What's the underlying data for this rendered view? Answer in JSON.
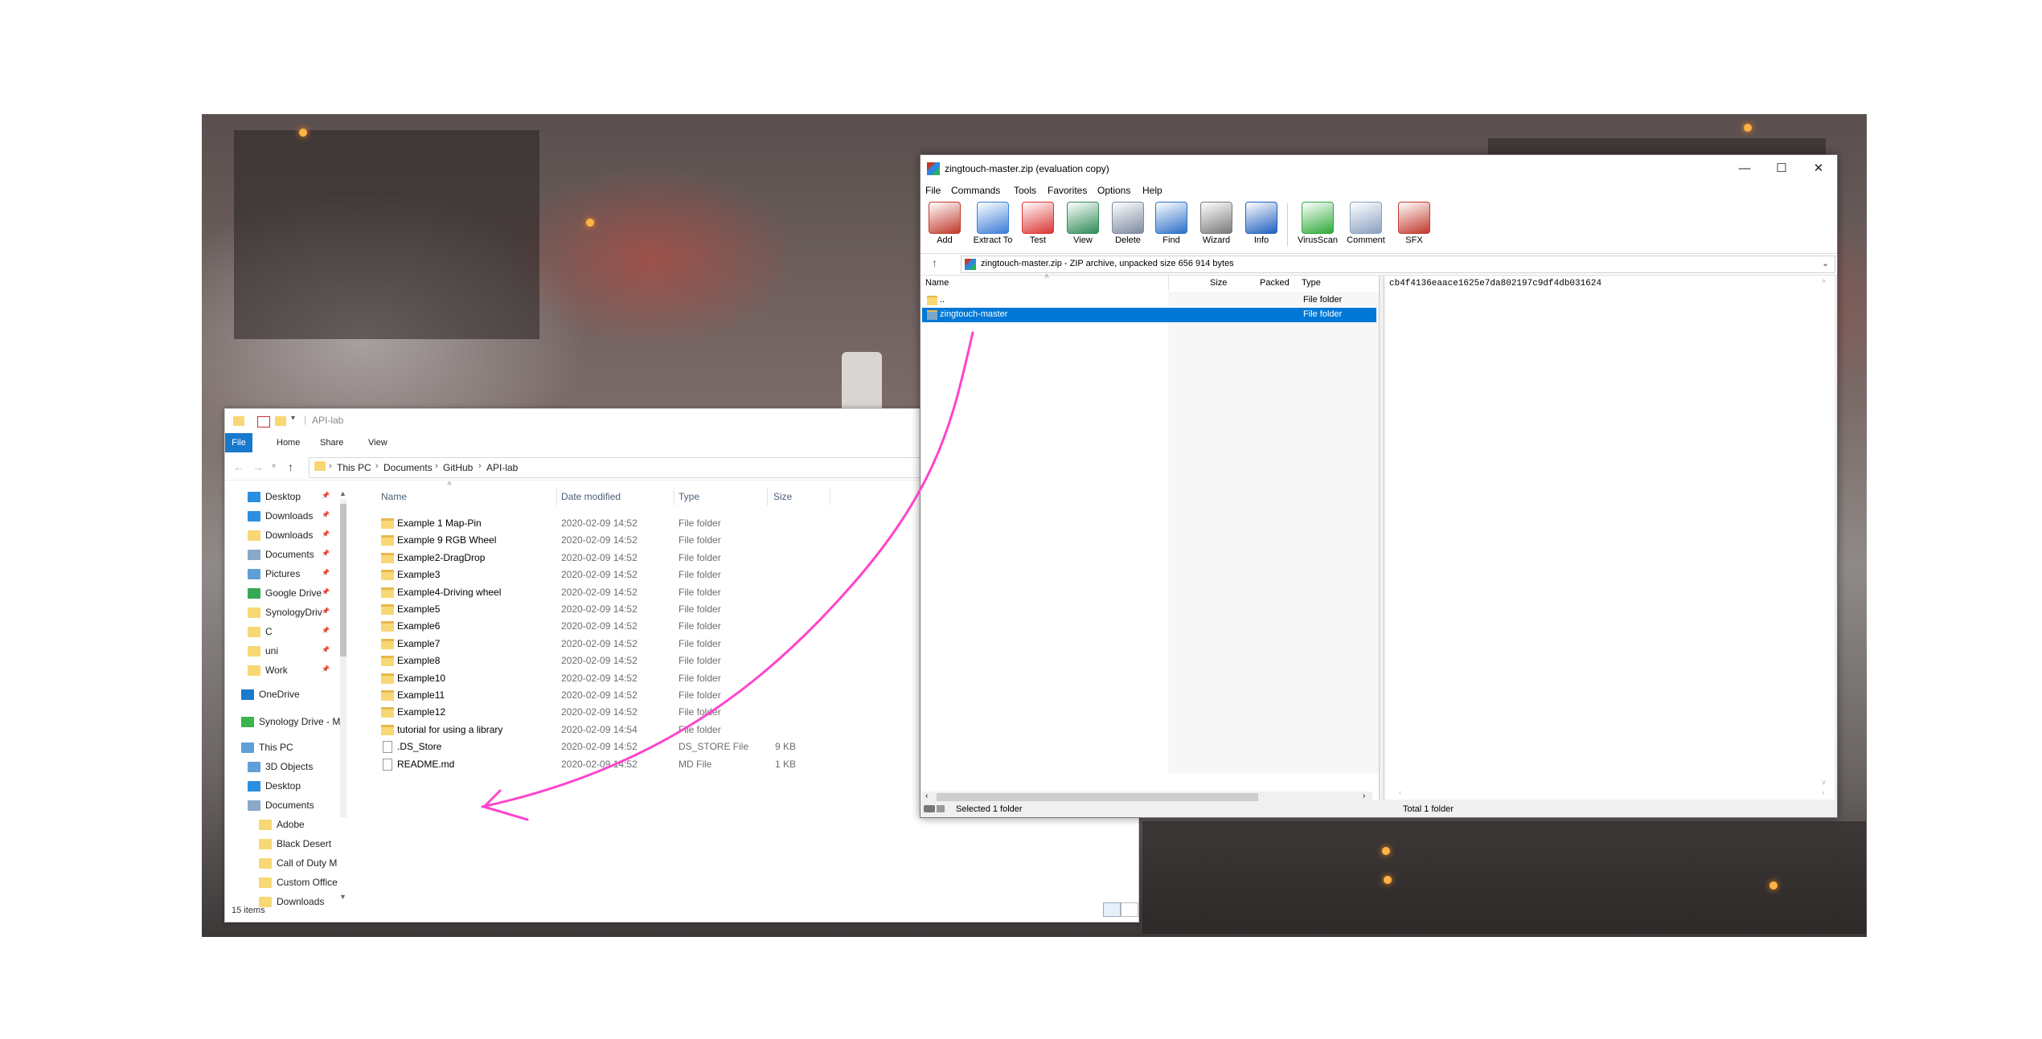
{
  "explorer": {
    "title": "API-lab",
    "ribbon_tabs": [
      "File",
      "Home",
      "Share",
      "View"
    ],
    "breadcrumb": [
      "This PC",
      "Documents",
      "GitHub",
      "API-lab"
    ],
    "nav_items": [
      {
        "label": "Desktop",
        "pinned": true,
        "color": "#2a8fe0"
      },
      {
        "label": "Downloads",
        "pinned": true,
        "color": "#2a8fe0"
      },
      {
        "label": "Downloads",
        "pinned": true,
        "color": "#f8d775"
      },
      {
        "label": "Documents",
        "pinned": true,
        "color": "#8aa8c8"
      },
      {
        "label": "Pictures",
        "pinned": true,
        "color": "#5fa0d8"
      },
      {
        "label": "Google Drive",
        "pinned": true,
        "color": "#34a853"
      },
      {
        "label": "SynologyDriv",
        "pinned": true,
        "color": "#f8d775"
      },
      {
        "label": "C",
        "pinned": true,
        "color": "#f8d775"
      },
      {
        "label": "uni",
        "pinned": true,
        "color": "#f8d775"
      },
      {
        "label": "Work",
        "pinned": true,
        "color": "#f8d775"
      },
      {
        "label": "OneDrive",
        "pinned": false,
        "color": "#1979ca"
      },
      {
        "label": "Synology Drive - M",
        "pinned": false,
        "color": "#3ab54a"
      },
      {
        "label": "This PC",
        "pinned": false,
        "color": "#5fa0d8"
      },
      {
        "label": "3D Objects",
        "pinned": false,
        "color": "#5fa0d8"
      },
      {
        "label": "Desktop",
        "pinned": false,
        "color": "#2a8fe0"
      },
      {
        "label": "Documents",
        "pinned": false,
        "color": "#8aa8c8"
      },
      {
        "label": "Adobe",
        "pinned": false,
        "color": "#f8d775"
      },
      {
        "label": "Black Desert",
        "pinned": false,
        "color": "#f8d775"
      },
      {
        "label": "Call of Duty M",
        "pinned": false,
        "color": "#f8d775"
      },
      {
        "label": "Custom Office",
        "pinned": false,
        "color": "#f8d775"
      },
      {
        "label": "Downloads",
        "pinned": false,
        "color": "#f8d775"
      }
    ],
    "columns": {
      "name": "Name",
      "date": "Date modified",
      "type": "Type",
      "size": "Size"
    },
    "files": [
      {
        "name": "Example 1 Map-Pin",
        "date": "2020-02-09 14:52",
        "type": "File folder",
        "size": "",
        "kind": "folder"
      },
      {
        "name": "Example 9 RGB Wheel",
        "date": "2020-02-09 14:52",
        "type": "File folder",
        "size": "",
        "kind": "folder"
      },
      {
        "name": "Example2-DragDrop",
        "date": "2020-02-09 14:52",
        "type": "File folder",
        "size": "",
        "kind": "folder"
      },
      {
        "name": "Example3",
        "date": "2020-02-09 14:52",
        "type": "File folder",
        "size": "",
        "kind": "folder"
      },
      {
        "name": "Example4-Driving wheel",
        "date": "2020-02-09 14:52",
        "type": "File folder",
        "size": "",
        "kind": "folder"
      },
      {
        "name": "Example5",
        "date": "2020-02-09 14:52",
        "type": "File folder",
        "size": "",
        "kind": "folder"
      },
      {
        "name": "Example6",
        "date": "2020-02-09 14:52",
        "type": "File folder",
        "size": "",
        "kind": "folder"
      },
      {
        "name": "Example7",
        "date": "2020-02-09 14:52",
        "type": "File folder",
        "size": "",
        "kind": "folder"
      },
      {
        "name": "Example8",
        "date": "2020-02-09 14:52",
        "type": "File folder",
        "size": "",
        "kind": "folder"
      },
      {
        "name": "Example10",
        "date": "2020-02-09 14:52",
        "type": "File folder",
        "size": "",
        "kind": "folder"
      },
      {
        "name": "Example11",
        "date": "2020-02-09 14:52",
        "type": "File folder",
        "size": "",
        "kind": "folder"
      },
      {
        "name": "Example12",
        "date": "2020-02-09 14:52",
        "type": "File folder",
        "size": "",
        "kind": "folder"
      },
      {
        "name": "tutorial for using a library",
        "date": "2020-02-09 14:54",
        "type": "File folder",
        "size": "",
        "kind": "folder"
      },
      {
        "name": ".DS_Store",
        "date": "2020-02-09 14:52",
        "type": "DS_STORE File",
        "size": "9 KB",
        "kind": "file"
      },
      {
        "name": "README.md",
        "date": "2020-02-09 14:52",
        "type": "MD File",
        "size": "1 KB",
        "kind": "file"
      }
    ],
    "status": "15 items"
  },
  "winrar": {
    "title": "zingtouch-master.zip (evaluation copy)",
    "menu": [
      "File",
      "Commands",
      "Tools",
      "Favorites",
      "Options",
      "Help"
    ],
    "toolbar": [
      {
        "label": "Add",
        "icon": "add-archive-icon",
        "color": "#c0392b"
      },
      {
        "label": "Extract To",
        "icon": "extract-folder-icon",
        "color": "#3b7dd8"
      },
      {
        "label": "Test",
        "icon": "test-clipboard-icon",
        "color": "#d33"
      },
      {
        "label": "View",
        "icon": "view-book-icon",
        "color": "#2e8b57"
      },
      {
        "label": "Delete",
        "icon": "trash-icon",
        "color": "#7d8ba0"
      },
      {
        "label": "Find",
        "icon": "magnifier-icon",
        "color": "#2a6fc9"
      },
      {
        "label": "Wizard",
        "icon": "wizard-wand-icon",
        "color": "#7a7a7a"
      },
      {
        "label": "Info",
        "icon": "info-icon",
        "color": "#1f5fbf"
      },
      {
        "label": "VirusScan",
        "icon": "virus-scan-icon",
        "color": "#2eaa3a"
      },
      {
        "label": "Comment",
        "icon": "comment-icon",
        "color": "#8aa0c0"
      },
      {
        "label": "SFX",
        "icon": "sfx-books-icon",
        "color": "#c0392b"
      }
    ],
    "address": "zingtouch-master.zip - ZIP archive, unpacked size 656 914 bytes",
    "columns": {
      "name": "Name",
      "size": "Size",
      "packed": "Packed",
      "type": "Type"
    },
    "rows": [
      {
        "name": "..",
        "type": "File folder",
        "selected": false
      },
      {
        "name": "zingtouch-master",
        "type": "File folder",
        "selected": true
      }
    ],
    "comment": "cb4f4136eaace1625e7da802197c9df4db031624",
    "status_left": "Selected 1 folder",
    "status_right": "Total 1 folder"
  }
}
